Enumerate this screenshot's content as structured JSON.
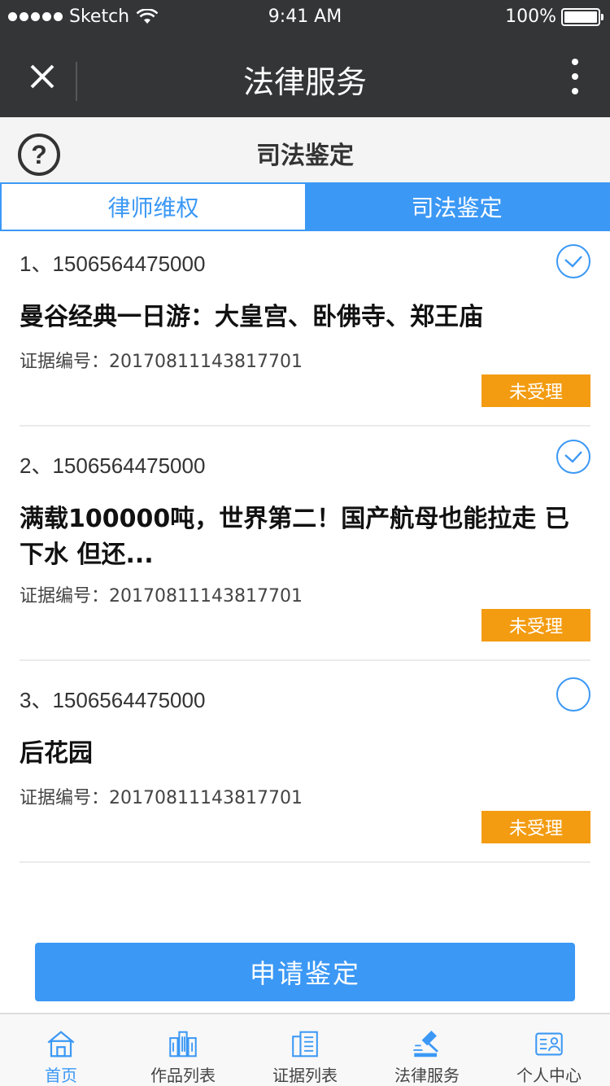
{
  "status_bar": {
    "carrier": "Sketch",
    "time": "9:41 AM",
    "battery": "100%"
  },
  "nav": {
    "title": "法律服务",
    "close_icon": "close-icon",
    "more_icon": "more-vertical-icon"
  },
  "header": {
    "help_symbol": "?",
    "title": "司法鉴定"
  },
  "tabs": [
    {
      "label": "律师维权",
      "active": false
    },
    {
      "label": "司法鉴定",
      "active": true
    }
  ],
  "items": [
    {
      "id": "1、1506564475000",
      "title": "曼谷经典一日游：大皇宫、卧佛寺、郑王庙",
      "evidence": "证据编号：20170811143817701",
      "status": "未受理",
      "checked": true
    },
    {
      "id": "2、1506564475000",
      "title": "满载100000吨，世界第二！国产航母也能拉走 已下水 但还...",
      "evidence": "证据编号：20170811143817701",
      "status": "未受理",
      "checked": true
    },
    {
      "id": "3、1506564475000",
      "title": "后花园",
      "evidence": "证据编号：20170811143817701",
      "status": "未受理",
      "checked": false
    }
  ],
  "apply_button": {
    "label": "申请鉴定"
  },
  "tab_bar": [
    {
      "label": "首页",
      "icon": "home-icon",
      "active": true
    },
    {
      "label": "作品列表",
      "icon": "buildings-icon",
      "active": false
    },
    {
      "label": "证据列表",
      "icon": "building-list-icon",
      "active": false
    },
    {
      "label": "法律服务",
      "icon": "gavel-icon",
      "active": false
    },
    {
      "label": "个人中心",
      "icon": "id-card-icon",
      "active": false
    }
  ],
  "colors": {
    "accent": "#3b98f5",
    "dark_bar": "#333537",
    "status_badge": "#f39c12"
  }
}
